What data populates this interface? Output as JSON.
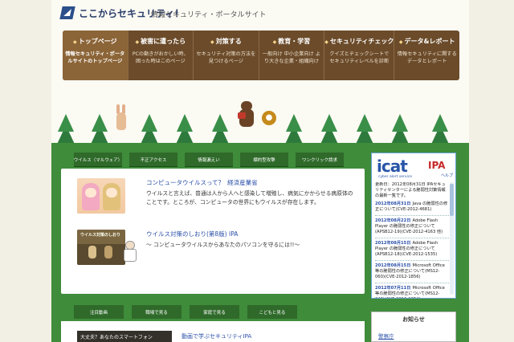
{
  "header": {
    "title": "ここからセキュリティ！",
    "subtitle": "情報セキュリティ・ポータルサイト"
  },
  "nav": [
    {
      "label": "トップページ",
      "desc": "情報セキュリティ・ポータルサイトのトップページ"
    },
    {
      "label": "被害に遭ったら",
      "desc": "PCの動きがおかしい時、困った時はこのページ"
    },
    {
      "label": "対策する",
      "desc": "セキュリティ対策の方法を見つけるページ"
    },
    {
      "label": "教育・学習",
      "desc": "一般向け 中小企業向け より大きな企業・組織向け"
    },
    {
      "label": "セキュリティチェック",
      "desc": "クイズとチェックシートでセキュリティレベルを診断"
    },
    {
      "label": "データ&レポート",
      "desc": "情報セキュリティに関するデータとレポート"
    }
  ],
  "tabs": [
    {
      "label": "ウイルス（マルウェア）"
    },
    {
      "label": "不正アクセス"
    },
    {
      "label": "情報漏えい"
    },
    {
      "label": "標的型攻撃"
    },
    {
      "label": "ワンクリック請求"
    }
  ],
  "articles": [
    {
      "title": "コンピュータウイルスって？",
      "source": "経済産業省",
      "body": "ウイルスと言えば、普通は人から人へと感染して増殖し、病気にかからせる病原体のことです。ところが、コンピュータの世界にもウイルスが存在します。"
    },
    {
      "title": "ウイルス対策のしおり(第8版) IPA",
      "thumb_text": "ウイルス対策のしおり",
      "body": "～ コンピュータウイルスからあなたのパソコンを守るには!!～"
    }
  ],
  "bottom_tabs": [
    {
      "label": "注目動画"
    },
    {
      "label": "職場で見る"
    },
    {
      "label": "家庭で見る"
    },
    {
      "label": "こどもと見る"
    }
  ],
  "video": {
    "thumb_text": "大丈夫？あなたのスマートフォン",
    "title": "動画で学ぶセキュリティIPA"
  },
  "icat": {
    "logo": "icat",
    "org": "IPA",
    "tagline": "cyber alert service",
    "help": "ヘルプ",
    "intro": "更新日：2012年08月31日 IPAセキュリティセンターによる脆弱性対策情報の最新一覧です。",
    "items": [
      {
        "date": "2012年08月31日",
        "text": "Java の脆弱性の修正について(CVE-2012-4681)"
      },
      {
        "date": "2012年08月22日",
        "text": "Adobe Flash Player の脆弱性の修正について(APSB12-19)(CVE-2012-4163 他)"
      },
      {
        "date": "2012年08月15日",
        "text": "Adobe Flash Player の脆弱性の修正について(APSB12-18)(CVE-2012-1535)"
      },
      {
        "date": "2012年08月15日",
        "text": "Microsoft Office 等の脆弱性の修正について(MS12-060)(CVE-2012-1856)"
      },
      {
        "date": "2012年07月11日",
        "text": "Microsoft Office 等の脆弱性の修正について(MS12-046)(CVE-2012-1854)"
      }
    ]
  },
  "notice": {
    "title": "お知らせ",
    "link": "警察庁"
  },
  "colors": {
    "nav_bg": "#6b4b2a",
    "tab_green": "#2f6a2a",
    "grass": "#3f8c3a",
    "link_blue": "#2a4fa8"
  }
}
